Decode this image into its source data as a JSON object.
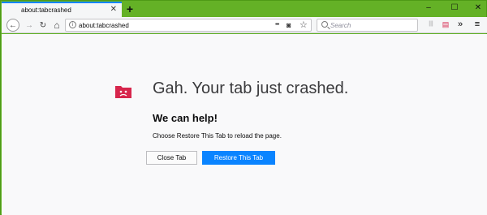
{
  "colors": {
    "window_frame": "#5fb022",
    "accent": "#0a84ff",
    "crash_icon": "#d7264c"
  },
  "tabbar": {
    "tab": {
      "title": "about:tabcrashed",
      "close_icon": "close-icon"
    },
    "new_tab_label": "+",
    "window_controls": {
      "minimize": "–",
      "maximize": "☐",
      "close": "✕"
    }
  },
  "toolbar": {
    "back": "←",
    "forward": "→",
    "reload": "↻",
    "home": "⌂",
    "url": "about:tabcrashed",
    "url_actions": {
      "more": "•••",
      "pocket": "◙",
      "bookmark": "☆"
    },
    "search": {
      "placeholder": "Search"
    },
    "right_icons": {
      "library": "|||",
      "reader": "▤",
      "overflow": "»",
      "menu": "≡"
    }
  },
  "crash_page": {
    "headline": "Gah. Your tab just crashed.",
    "subheading": "We can help!",
    "description": "Choose Restore This Tab to reload the page.",
    "close_tab_label": "Close Tab",
    "restore_tab_label": "Restore This Tab"
  }
}
